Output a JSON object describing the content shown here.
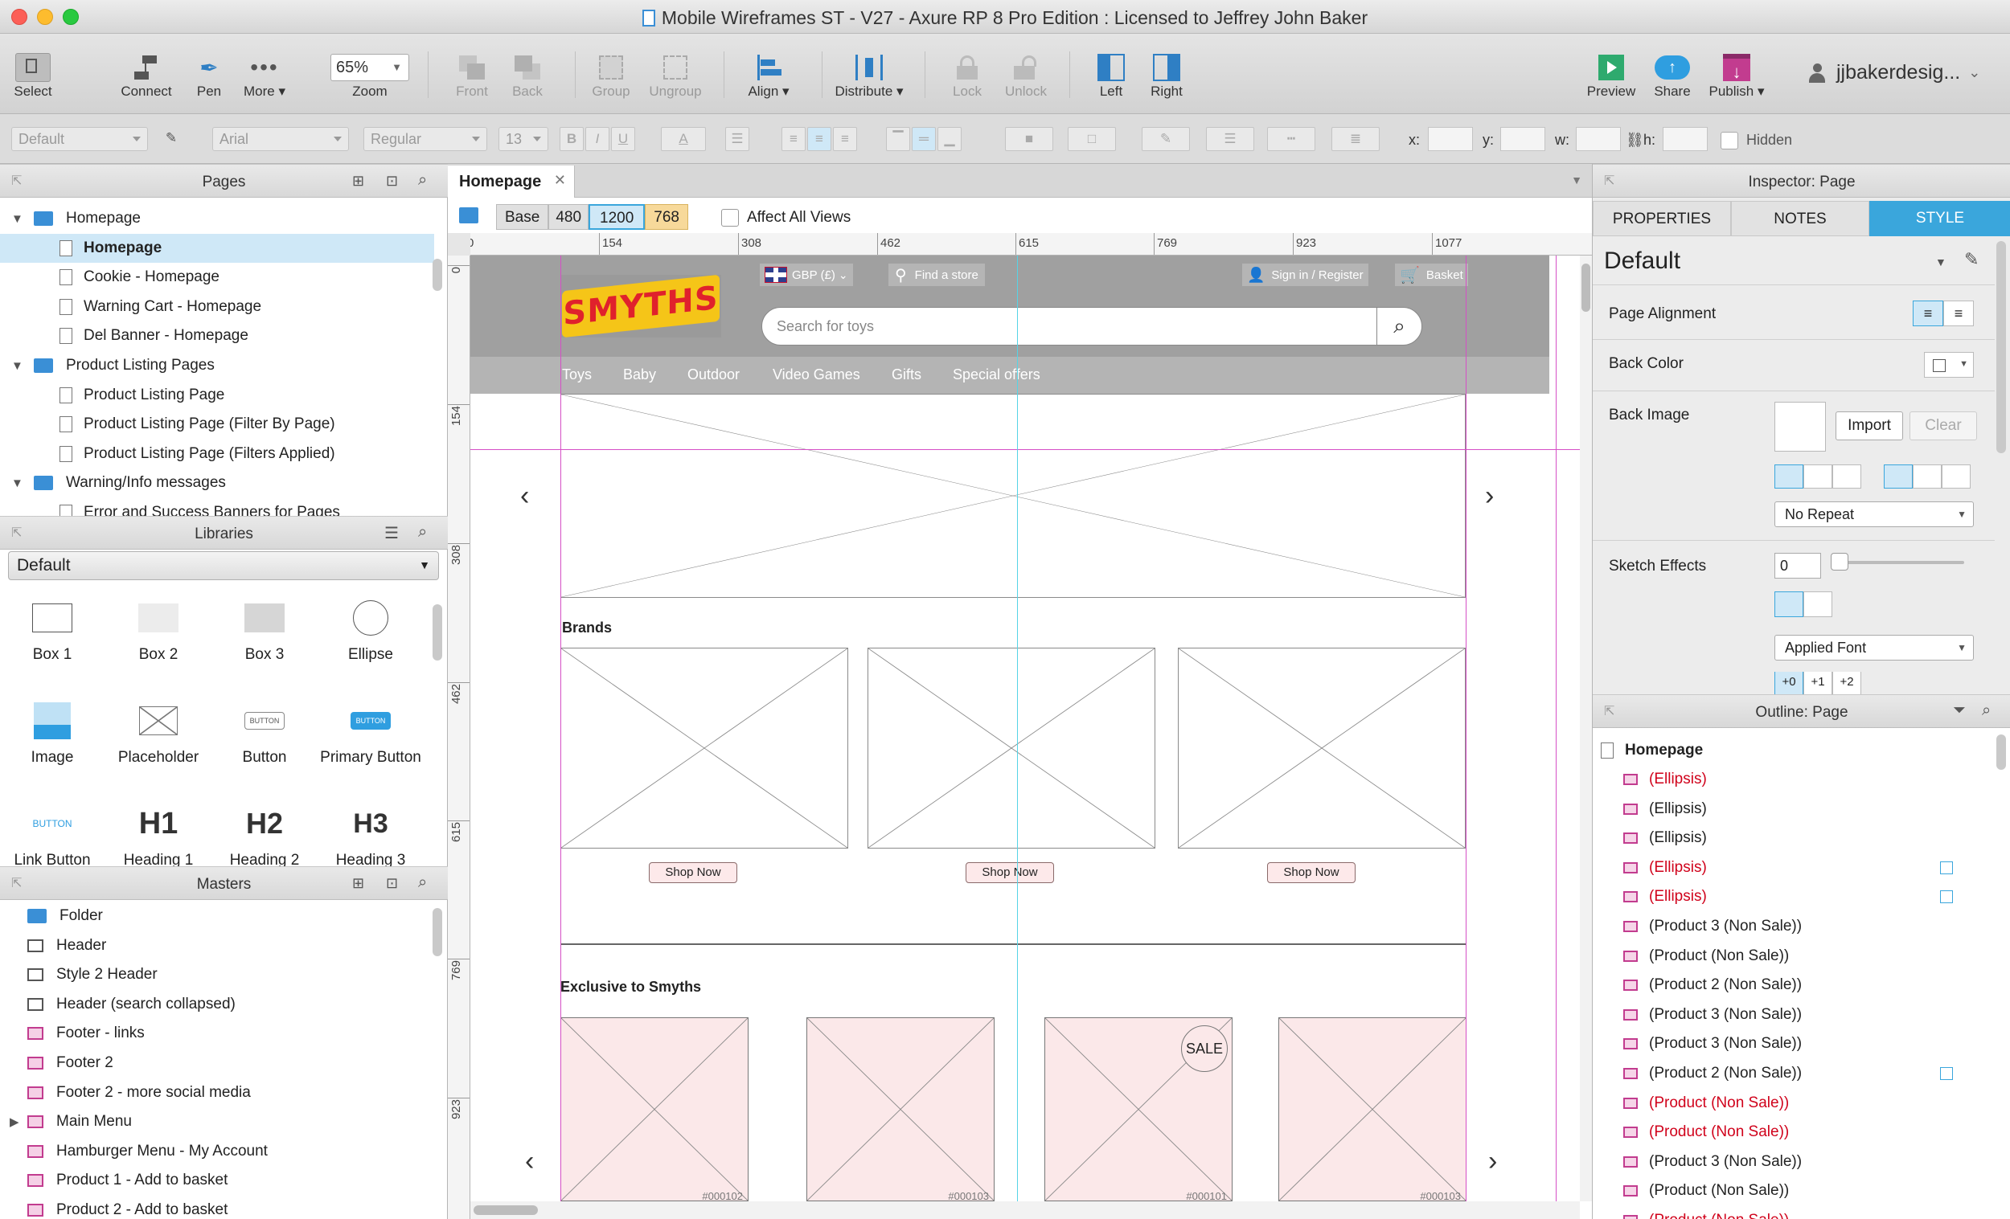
{
  "window": {
    "title": "Mobile Wireframes ST - V27 - Axure RP 8 Pro Edition : Licensed to Jeffrey John Baker"
  },
  "toolbar": {
    "select": "Select",
    "connect": "Connect",
    "pen": "Pen",
    "more": "More ▾",
    "zoom_value": "65%",
    "zoom": "Zoom",
    "front": "Front",
    "back": "Back",
    "group": "Group",
    "ungroup": "Ungroup",
    "align": "Align ▾",
    "distribute": "Distribute ▾",
    "lock": "Lock",
    "unlock": "Unlock",
    "left": "Left",
    "right": "Right",
    "preview": "Preview",
    "share": "Share",
    "publish": "Publish ▾",
    "user": "jjbakerdesig..."
  },
  "formatbar": {
    "style": "Default",
    "font": "Arial",
    "weight": "Regular",
    "size": "13",
    "bold": "B",
    "italic": "I",
    "underline": "U",
    "font_color": "A",
    "x_label": "x:",
    "y_label": "y:",
    "w_label": "w:",
    "h_label": "h:",
    "hidden": "Hidden"
  },
  "pages": {
    "title": "Pages",
    "items": [
      {
        "label": "Homepage",
        "type": "folder"
      },
      {
        "label": "Homepage",
        "type": "page"
      },
      {
        "label": "Cookie - Homepage",
        "type": "page"
      },
      {
        "label": "Warning Cart - Homepage",
        "type": "page"
      },
      {
        "label": "Del Banner - Homepage",
        "type": "page"
      },
      {
        "label": "Product Listing Pages",
        "type": "folder"
      },
      {
        "label": "Product Listing Page",
        "type": "page"
      },
      {
        "label": "Product Listing Page (Filter By Page)",
        "type": "page"
      },
      {
        "label": "Product Listing Page (Filters Applied)",
        "type": "page"
      },
      {
        "label": "Warning/Info messages",
        "type": "folder"
      },
      {
        "label": "Error and Success Banners for Pages",
        "type": "page"
      }
    ]
  },
  "libraries": {
    "title": "Libraries",
    "selected": "Default",
    "items": [
      "Box 1",
      "Box 2",
      "Box 3",
      "Ellipse",
      "Image",
      "Placeholder",
      "Button",
      "Primary Button",
      "Link Button",
      "Heading 1",
      "Heading 2",
      "Heading 3"
    ],
    "button_text": "BUTTON",
    "h1": "H1",
    "h2": "H2",
    "h3": "H3"
  },
  "masters": {
    "title": "Masters",
    "items": [
      "Folder",
      "Header",
      "Style 2 Header",
      "Header (search collapsed)",
      "Footer - links",
      "Footer 2",
      "Footer 2 - more social media",
      "Main Menu",
      "Hamburger Menu - My Account",
      "Product 1 - Add to basket",
      "Product 2 - Add to basket"
    ]
  },
  "canvas": {
    "tab": "Homepage",
    "views": {
      "base": "Base",
      "v480": "480",
      "v1200": "1200",
      "v768": "768",
      "affect_all": "Affect All Views"
    },
    "ruler_h": [
      "0",
      "154",
      "308",
      "462",
      "615",
      "769",
      "923",
      "1077"
    ],
    "ruler_v": [
      "0",
      "154",
      "308",
      "462",
      "615",
      "769",
      "923"
    ],
    "header": {
      "logo": "SMYTHS",
      "currency": "GBP (£)",
      "find_store": "Find a store",
      "sign_in": "Sign in / Register",
      "basket": "Basket",
      "search_placeholder": "Search for toys",
      "nav": [
        "Toys",
        "Baby",
        "Outdoor",
        "Video Games",
        "Gifts",
        "Special offers"
      ]
    },
    "brands_heading": "Brands",
    "shop_now": "Shop Now",
    "exclusive_heading": "Exclusive to Smyths",
    "sale_badge": "SALE",
    "product_codes": [
      "#000102",
      "#000103",
      "#000101",
      "#000103"
    ]
  },
  "inspector": {
    "title": "Inspector: Page",
    "tabs": [
      "PROPERTIES",
      "NOTES",
      "STYLE"
    ],
    "style_name": "Default",
    "page_alignment": "Page Alignment",
    "back_color": "Back Color",
    "back_image": "Back Image",
    "import": "Import",
    "clear": "Clear",
    "repeat": "No Repeat",
    "sketch_effects": "Sketch Effects",
    "sketch_value": "0",
    "applied_font": "Applied Font",
    "font_steps": [
      "+0",
      "+1",
      "+2"
    ]
  },
  "outline": {
    "title": "Outline: Page",
    "root": "Homepage",
    "items": [
      {
        "label": "(Ellipsis)",
        "red": true,
        "flag": false
      },
      {
        "label": "(Ellipsis)",
        "red": false,
        "flag": false
      },
      {
        "label": "(Ellipsis)",
        "red": false,
        "flag": false
      },
      {
        "label": "(Ellipsis)",
        "red": true,
        "flag": true
      },
      {
        "label": "(Ellipsis)",
        "red": true,
        "flag": true
      },
      {
        "label": "(Product 3 (Non Sale))",
        "red": false,
        "flag": false
      },
      {
        "label": "(Product (Non Sale))",
        "red": false,
        "flag": false
      },
      {
        "label": "(Product 2 (Non Sale))",
        "red": false,
        "flag": false
      },
      {
        "label": "(Product 3 (Non Sale))",
        "red": false,
        "flag": false
      },
      {
        "label": "(Product 3 (Non Sale))",
        "red": false,
        "flag": false
      },
      {
        "label": "(Product 2 (Non Sale))",
        "red": false,
        "flag": true
      },
      {
        "label": "(Product (Non Sale))",
        "red": true,
        "flag": false
      },
      {
        "label": "(Product (Non Sale))",
        "red": true,
        "flag": false
      },
      {
        "label": "(Product 3 (Non Sale))",
        "red": false,
        "flag": false
      },
      {
        "label": "(Product (Non Sale))",
        "red": false,
        "flag": false
      },
      {
        "label": "(Product (Non Sale))",
        "red": true,
        "flag": false
      }
    ]
  },
  "colors": {
    "accent": "#3aa6dc",
    "selection": "#cfe8f7",
    "red_text": "#d0021b",
    "guide_pink": "#d54fc6",
    "guide_cyan": "#56d4e6"
  }
}
